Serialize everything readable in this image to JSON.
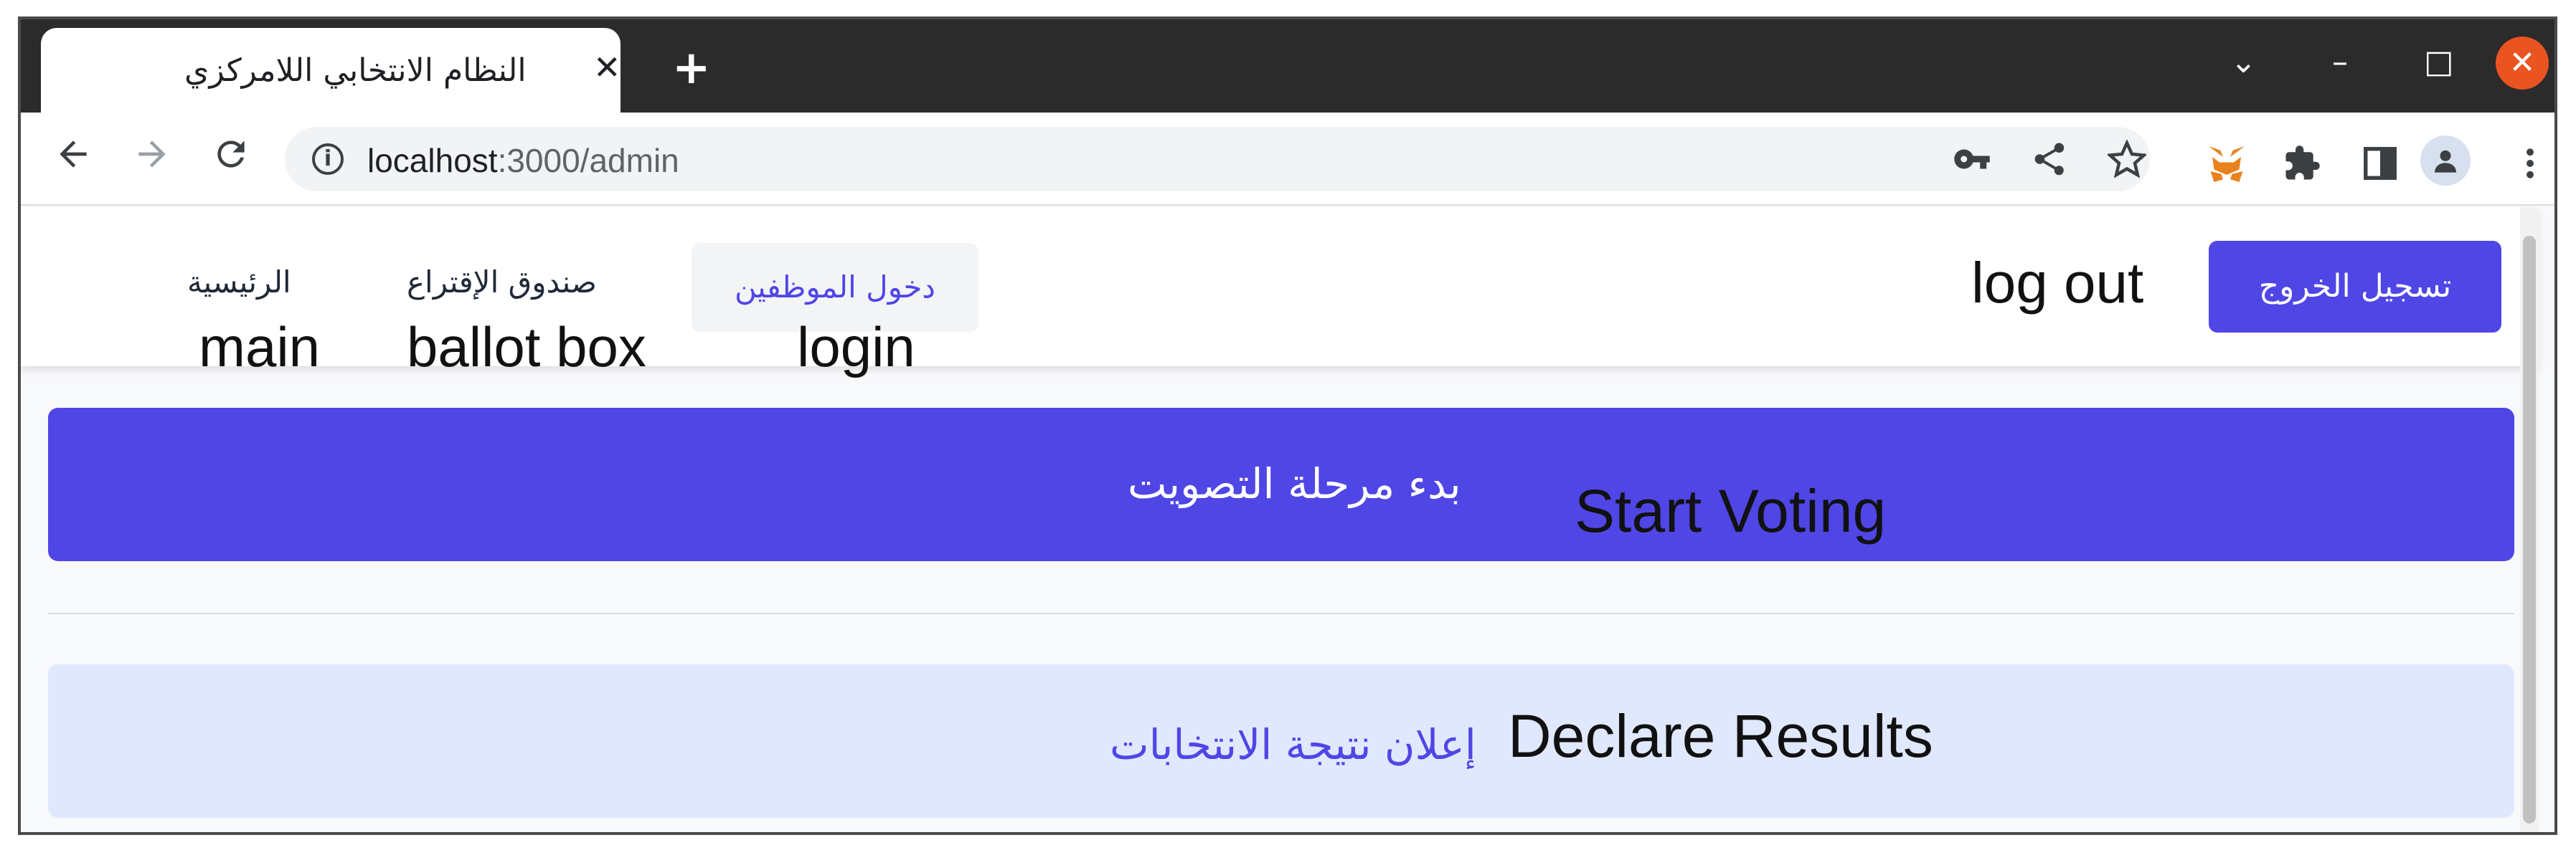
{
  "browser": {
    "tab_title": "النظام الانتخابي اللامركزي",
    "tab_close": "✕",
    "new_tab": "+",
    "url_host": "localhost",
    "url_rest": ":3000/admin",
    "window_controls": {
      "dropdown": "⌄",
      "minimize": "–",
      "maximize": "□",
      "close": "✕"
    }
  },
  "icons": {
    "back": "arrow-left-icon",
    "forward": "arrow-right-icon",
    "reload": "reload-icon",
    "info": "info-icon",
    "key": "key-icon",
    "share": "share-icon",
    "star": "star-icon",
    "metamask": "metamask-fox-icon",
    "extensions": "puzzle-icon",
    "sidepanel": "side-panel-icon",
    "profile": "profile-icon",
    "menu": "kebab-menu-icon"
  },
  "navbar": {
    "home_ar": "الرئيسية",
    "home_en": "main",
    "ballot_ar": "صندوق الإقتراع",
    "ballot_en": "ballot box",
    "login_ar": "دخول الموظفين",
    "login_en": "login",
    "logout_en": "log out",
    "logout_ar": "تسجيل الخروج"
  },
  "actions": {
    "start_ar": "بدء مرحلة التصويت",
    "start_en": "Start Voting",
    "declare_ar": "إعلان نتيجة الانتخابات",
    "declare_en": "Declare Results"
  },
  "colors": {
    "accent": "#4f46e5",
    "declare_bg": "#e0e8fd",
    "titlebar": "#2b2b2b"
  }
}
